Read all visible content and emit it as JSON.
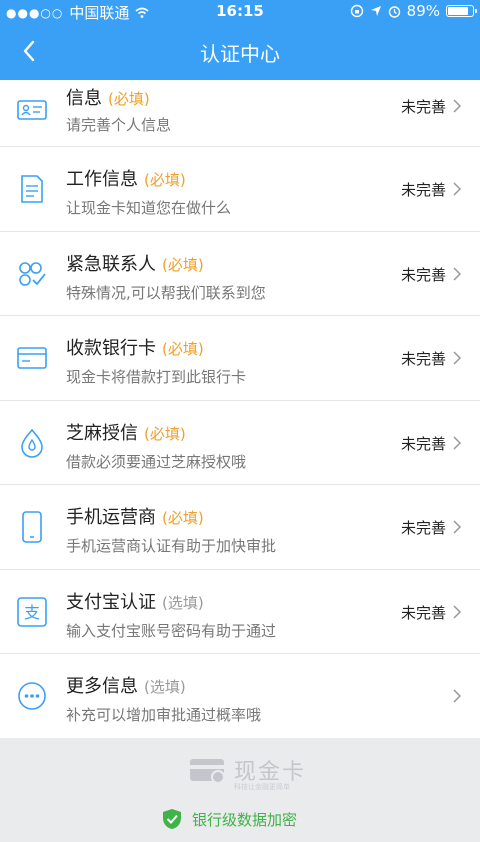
{
  "status_bar": {
    "carrier": "中国联通",
    "time": "16:15",
    "battery": "89%",
    "battery_level": 0.89
  },
  "nav": {
    "title": "认证中心"
  },
  "items": [
    {
      "title": "信息",
      "tag": "(必填)",
      "desc": "请完善个人信息",
      "status": "未完善",
      "icon": "id-card-icon"
    },
    {
      "title": "工作信息",
      "tag": "(必填)",
      "desc": "让现金卡知道您在做什么",
      "status": "未完善",
      "icon": "document-icon"
    },
    {
      "title": "紧急联系人",
      "tag": "(必填)",
      "desc": "特殊情况,可以帮我们联系到您",
      "status": "未完善",
      "icon": "contacts-icon"
    },
    {
      "title": "收款银行卡",
      "tag": "(必填)",
      "desc": "现金卡将借款打到此银行卡",
      "status": "未完善",
      "icon": "bank-card-icon"
    },
    {
      "title": "芝麻授信",
      "tag": "(必填)",
      "desc": "借款必须要通过芝麻授权哦",
      "status": "未完善",
      "icon": "sesame-icon"
    },
    {
      "title": "手机运营商",
      "tag": "(必填)",
      "desc": "手机运营商认证有助于加快审批",
      "status": "未完善",
      "icon": "phone-icon"
    },
    {
      "title": "支付宝认证",
      "tag": "(选填)",
      "desc": "输入支付宝账号密码有助于通过",
      "status": "未完善",
      "icon": "alipay-icon"
    },
    {
      "title": "更多信息",
      "tag": "(选填)",
      "desc": "补充可以增加审批通过概率哦",
      "status": "",
      "icon": "more-icon"
    }
  ],
  "footer": {
    "brand": "现金卡",
    "slogan": "科技让金融更简单",
    "security": "银行级数据加密"
  },
  "colors": {
    "primary": "#3aa0f5",
    "required": "#f0a02a",
    "secure": "#3fb24a"
  }
}
